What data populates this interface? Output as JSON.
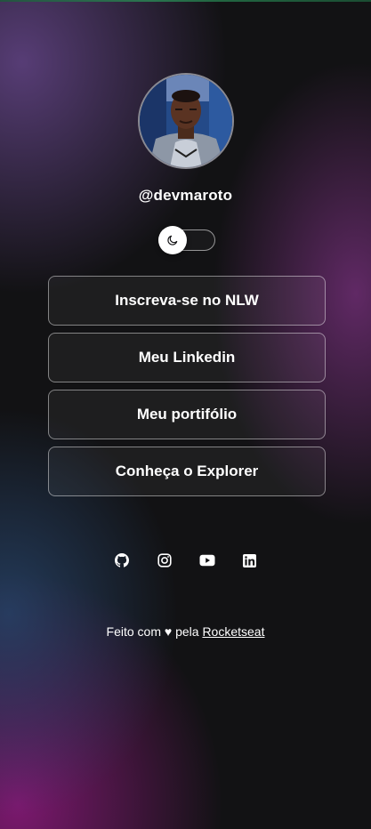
{
  "profile": {
    "handle": "@devmaroto",
    "avatar_alt": "devmaroto"
  },
  "theme_switch": {
    "icon": "moon-icon",
    "state": "dark"
  },
  "links": [
    {
      "label": "Inscreva-se no NLW"
    },
    {
      "label": "Meu Linkedin"
    },
    {
      "label": "Meu portifólio"
    },
    {
      "label": "Conheça o Explorer"
    }
  ],
  "social": [
    {
      "icon": "github-icon"
    },
    {
      "icon": "instagram-icon"
    },
    {
      "icon": "youtube-icon"
    },
    {
      "icon": "linkedin-icon"
    }
  ],
  "footer": {
    "prefix": "Feito com",
    "heart": "♥",
    "middle": "pela",
    "link_text": "Rocketseat"
  },
  "colors": {
    "background": "#121214",
    "text": "#ffffff",
    "accent_purple": "#6e2d73",
    "accent_blue": "#28466e",
    "accent_magenta": "#871978"
  }
}
